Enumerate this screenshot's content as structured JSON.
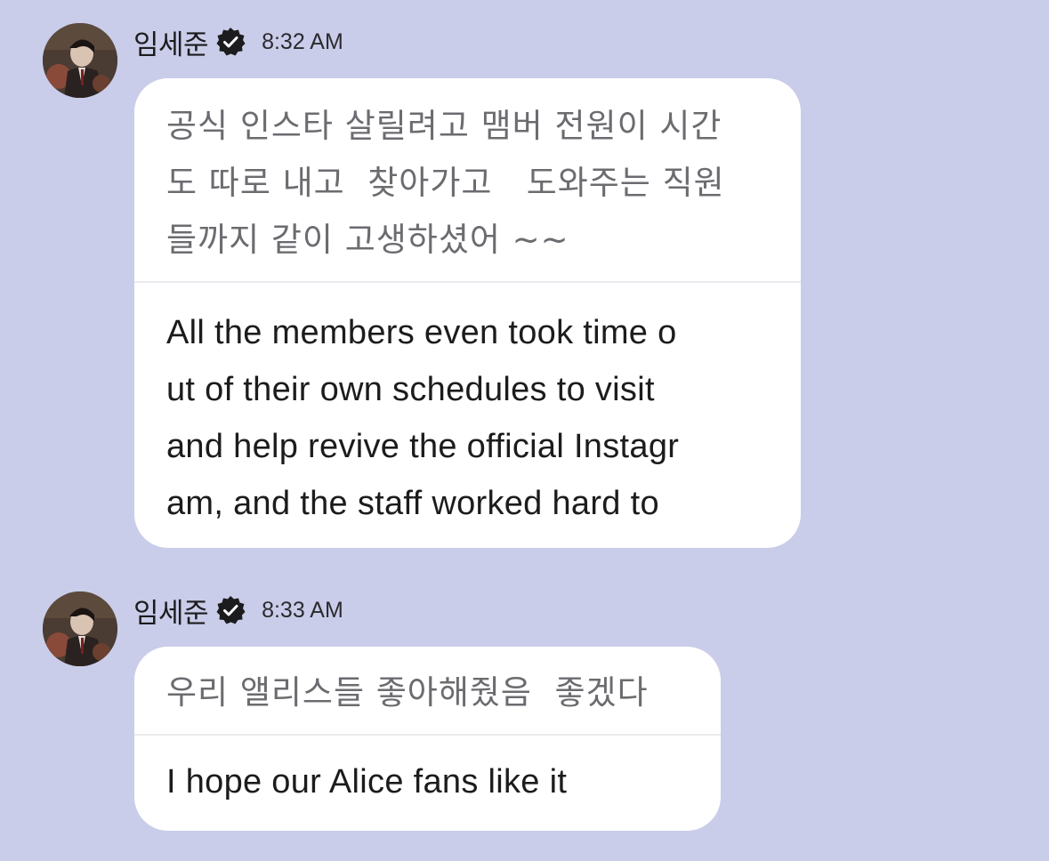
{
  "messages": [
    {
      "sender": "임세준",
      "time": "8:32 AM",
      "original": "공식 인스타 살릴려고 맴버 전원이 시간\n도 따로 내고  찾아가고   도와주는 직원\n들까지 같이 고생하셨어 ~~",
      "translation": "All the members even took time o\nut of their own schedules to visit\nand help revive the official Instagr\nam, and the staff worked hard to"
    },
    {
      "sender": "임세준",
      "time": "8:33 AM",
      "original": "우리 앨리스들 좋아해줬음  좋겠다",
      "translation": "I hope our Alice fans like it"
    }
  ],
  "icons": {
    "verified": "verified-badge-icon",
    "avatar": "profile-photo"
  },
  "colors": {
    "background": "#c9cde9",
    "bubble": "#ffffff",
    "original_text": "#6b6b70",
    "translated_text": "#1c1c1e"
  }
}
